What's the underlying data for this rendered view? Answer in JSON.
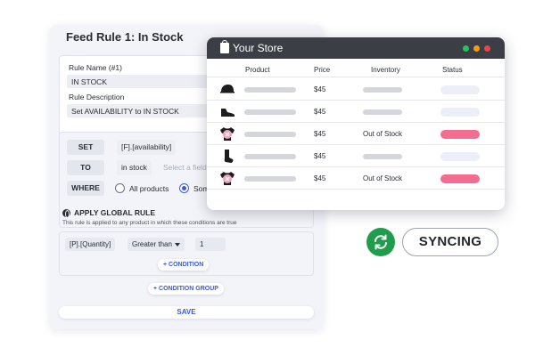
{
  "rule": {
    "title": "Feed Rule 1: In Stock",
    "name_label": "Rule Name (#1)",
    "name_value": "IN STOCK",
    "desc_label": "Rule Description",
    "desc_value": "Set AVAILABILITY to IN STOCK",
    "set_label": "SET",
    "set_field": "[F].[availability]",
    "to_label": "TO",
    "to_value": "in stock",
    "to_placeholder": "Select a field or",
    "where_label": "WHERE",
    "where_opt_all": "All products",
    "where_opt_some": "Som",
    "where_selected": "Som",
    "global_title": "APPLY GLOBAL RULE",
    "global_subtitle": "This rule is applied to any product in which these conditions are true",
    "cond_field": "[P].[Quantity]",
    "cond_operator": "Greater than",
    "cond_value": "1",
    "add_condition": "+ CONDITION",
    "add_condition_group": "+ CONDITION GROUP",
    "save": "SAVE"
  },
  "store": {
    "title": "Your Store",
    "window_dots": [
      "#22c55e",
      "#f59e0b",
      "#ef4444"
    ],
    "headers": {
      "product": "Product",
      "price": "Price",
      "inventory": "Inventory",
      "status": "Status"
    },
    "rows": [
      {
        "icon": "cap-icon",
        "price": "$45",
        "inventory": "",
        "status": "synced"
      },
      {
        "icon": "shoe-icon",
        "price": "$45",
        "inventory": "",
        "status": "synced"
      },
      {
        "icon": "shirt-out-of-stock-icon",
        "price": "$45",
        "inventory": "Out of Stock",
        "status": "error"
      },
      {
        "icon": "sock-icon",
        "price": "$45",
        "inventory": "",
        "status": "synced"
      },
      {
        "icon": "shirt-out-of-stock-icon",
        "price": "$45",
        "inventory": "Out of Stock",
        "status": "error"
      }
    ],
    "status_colors": {
      "synced": "#eceef8",
      "error": "#f26d8f"
    }
  },
  "sync": {
    "label": "SYNCING",
    "color": "#1f9d4c",
    "icon": "refresh-icon"
  }
}
